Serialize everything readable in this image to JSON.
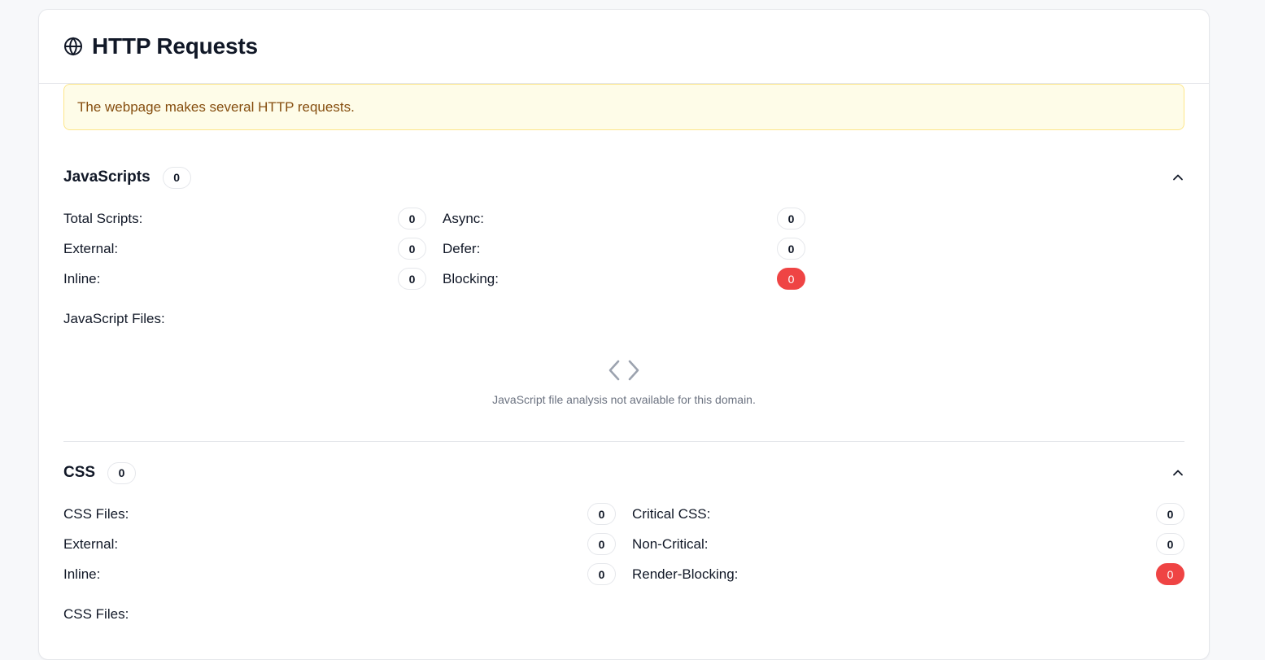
{
  "card": {
    "title": "HTTP Requests",
    "icon": "globe-icon"
  },
  "notice": {
    "text": "The webpage makes several HTTP requests."
  },
  "javascripts": {
    "title": "JavaScripts",
    "count": "0",
    "left_stats": [
      {
        "label": "Total Scripts:",
        "value": "0"
      },
      {
        "label": "External:",
        "value": "0"
      },
      {
        "label": "Inline:",
        "value": "0"
      }
    ],
    "right_stats": [
      {
        "label": "Async:",
        "value": "0"
      },
      {
        "label": "Defer:",
        "value": "0"
      },
      {
        "label": "Blocking:",
        "value": "0"
      }
    ],
    "files_label": "JavaScript Files:",
    "empty_icon": "code-icon",
    "empty_text": "JavaScript file analysis not available for this domain."
  },
  "css": {
    "title": "CSS",
    "count": "0",
    "left_stats": [
      {
        "label": "CSS Files:",
        "value": "0"
      },
      {
        "label": "External:",
        "value": "0"
      },
      {
        "label": "Inline:",
        "value": "0"
      }
    ],
    "right_stats": [
      {
        "label": "Critical CSS:",
        "value": "0"
      },
      {
        "label": "Non-Critical:",
        "value": "0"
      },
      {
        "label": "Render-Blocking:",
        "value": "0"
      }
    ],
    "files_label": "CSS Files:"
  },
  "colors": {
    "danger": "#ef4444",
    "notice_bg": "#fefce8",
    "notice_text": "#854d0e"
  }
}
